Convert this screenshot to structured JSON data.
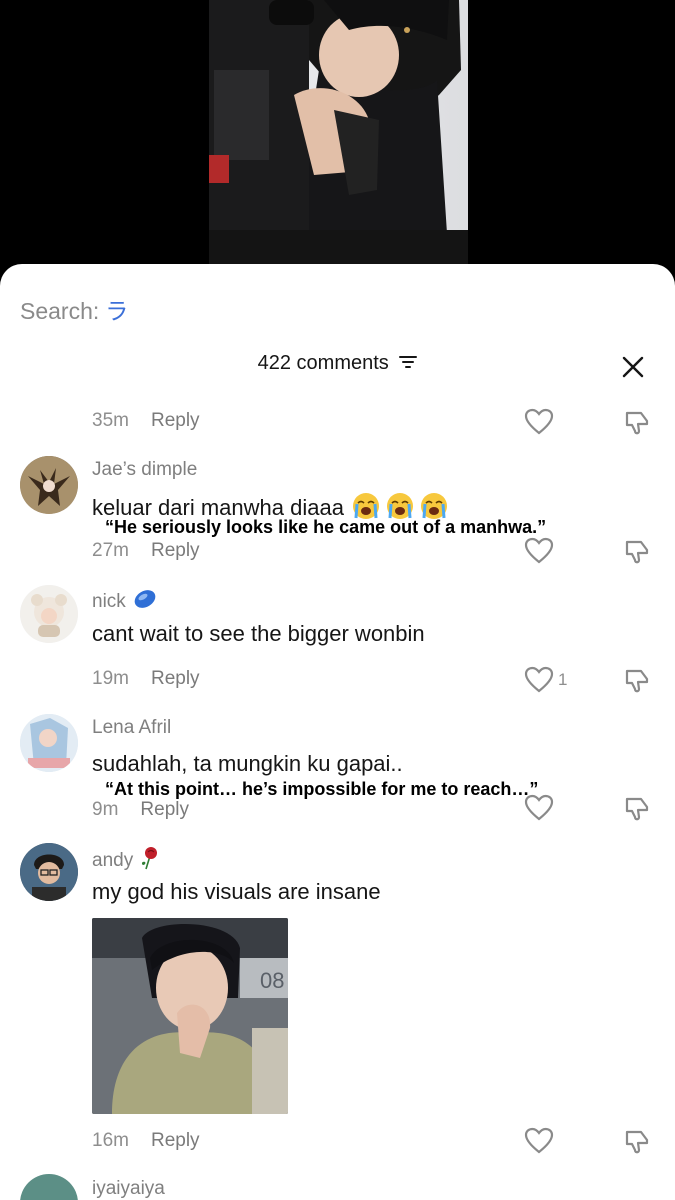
{
  "search": {
    "label": "Search:",
    "query": "ラ"
  },
  "header": {
    "comment_count": "422 comments"
  },
  "comments": [
    {
      "time": "35m",
      "reply": "Reply"
    },
    {
      "username": "Jae’s dimple",
      "text": "keluar dari manwha diaaa",
      "translation": "“He seriously looks like he came out of a manhwa.”",
      "time": "27m",
      "reply": "Reply"
    },
    {
      "username": "nick",
      "text": "cant wait to see the bigger wonbin",
      "time": "19m",
      "reply": "Reply",
      "likes": "1"
    },
    {
      "username": "Lena Afril",
      "text": "sudahlah, ta mungkin ku gapai..",
      "translation": "“At this point… he’s impossible for me to reach…”",
      "time": "9m",
      "reply": "Reply"
    },
    {
      "username": "andy",
      "text": "my god his visuals are insane",
      "time": "16m",
      "reply": "Reply",
      "photo_text": "08"
    },
    {
      "username": "iyaiyaiya"
    }
  ]
}
